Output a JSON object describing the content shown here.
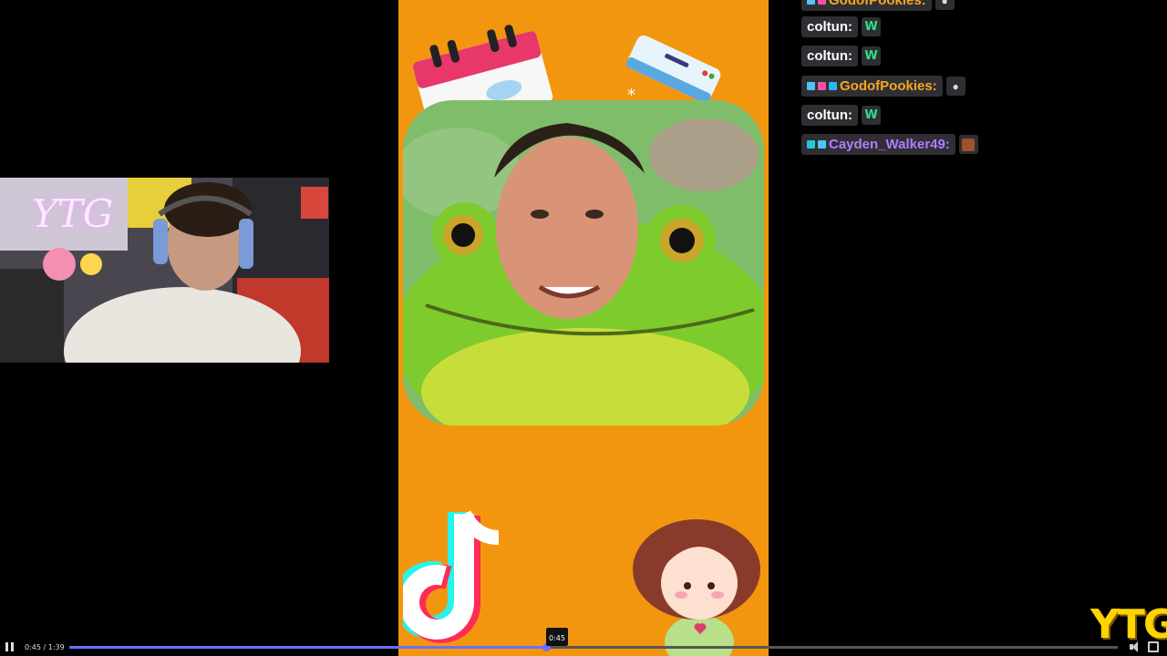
{
  "webcam": {
    "neon_sign": "YTG"
  },
  "video": {
    "brand_logo": "YTG"
  },
  "chat": {
    "messages": [
      {
        "user": "GodofPookies:",
        "color": "#f5a623",
        "emote": "ghost",
        "partial": true
      },
      {
        "user": "coltun:",
        "color": "#ffffff",
        "emote": "W"
      },
      {
        "user": "coltun:",
        "color": "#ffffff",
        "emote": "W"
      },
      {
        "user": "GodofPookies:",
        "color": "#f5a623",
        "emote": "ghost"
      },
      {
        "user": "coltun:",
        "color": "#ffffff",
        "emote": "W"
      },
      {
        "user": "Cayden_Walker49:",
        "color": "#b07cff",
        "emote": "face"
      }
    ]
  },
  "player": {
    "time_display": "0:45 / 1:39",
    "hover_time": "0:45",
    "progress": 0.4545,
    "accent": "#6d6dff"
  }
}
